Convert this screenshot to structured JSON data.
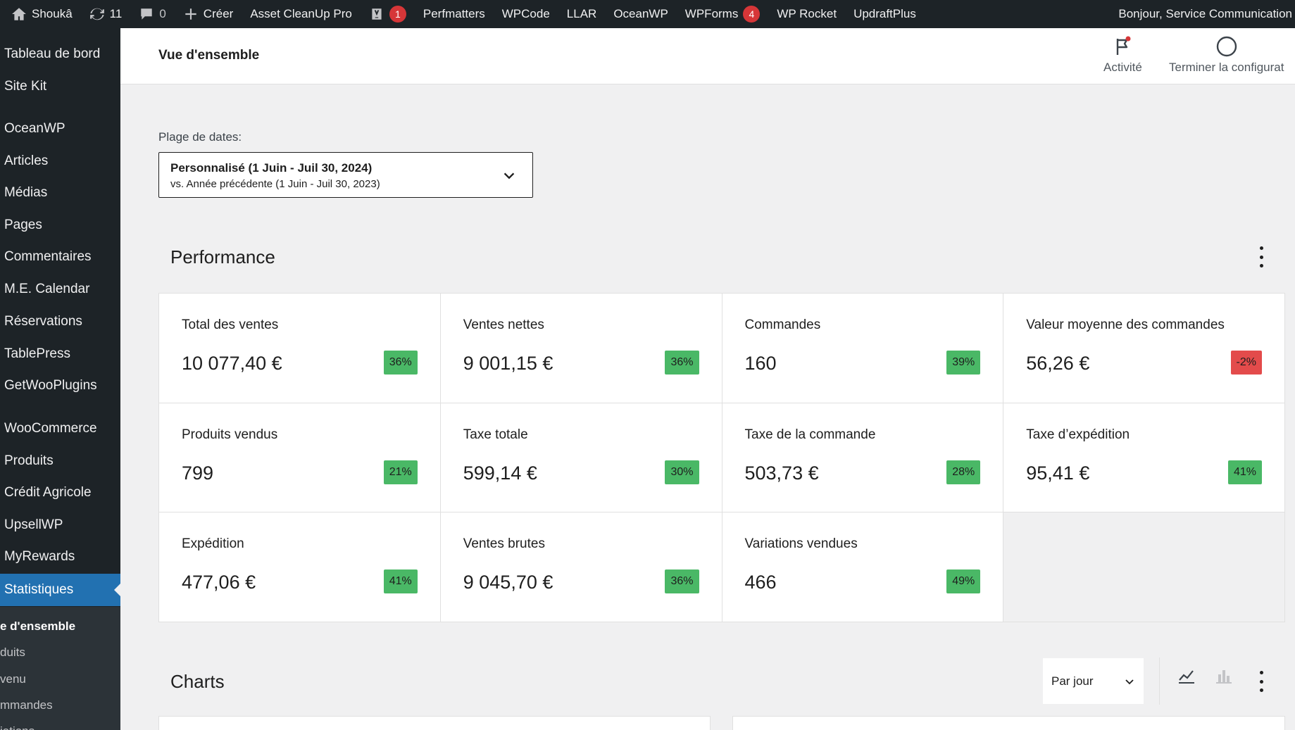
{
  "adminbar": {
    "site_name": "Shoukâ",
    "updates_count": "11",
    "comments_count": "0",
    "create_label": "Créer",
    "items": [
      {
        "label": "Asset CleanUp Pro"
      },
      {
        "label": "",
        "badge": "1",
        "icon": "yoast-icon"
      },
      {
        "label": "Perfmatters"
      },
      {
        "label": "WPCode"
      },
      {
        "label": "LLAR"
      },
      {
        "label": "OceanWP"
      },
      {
        "label": "WPForms",
        "badge": "4"
      },
      {
        "label": "WP Rocket"
      },
      {
        "label": "UpdraftPlus"
      }
    ],
    "greeting": "Bonjour, Service Communication"
  },
  "sidebar": {
    "items": [
      {
        "label": "Tableau de bord",
        "top": 0
      },
      {
        "label": "Site Kit"
      },
      {
        "label": "OceanWP"
      },
      {
        "label": "Articles"
      },
      {
        "label": "Médias"
      },
      {
        "label": "Pages"
      },
      {
        "label": "Commentaires"
      },
      {
        "label": "M.E. Calendar"
      },
      {
        "label": "Réservations"
      },
      {
        "label": "TablePress"
      },
      {
        "label": "GetWooPlugins"
      },
      {
        "label": "WooCommerce"
      },
      {
        "label": "Produits"
      },
      {
        "label": "Crédit Agricole"
      },
      {
        "label": "UpsellWP"
      },
      {
        "label": "MyRewards"
      },
      {
        "label": "Statistiques"
      }
    ],
    "submenu": [
      {
        "label": "e d'ensemble"
      },
      {
        "label": "duits"
      },
      {
        "label": "venu"
      },
      {
        "label": "mmandes"
      },
      {
        "label": "iations"
      }
    ]
  },
  "header": {
    "title": "Vue d'ensemble",
    "activity_label": "Activité",
    "setup_label": "Terminer la configurat"
  },
  "date_range": {
    "label": "Plage de dates:",
    "primary": "Personnalisé (1 Juin - Juil 30, 2024)",
    "comparison": "vs. Année précédente (1 Juin - Juil 30, 2023)"
  },
  "performance": {
    "title": "Performance",
    "cells": [
      {
        "label": "Total des ventes",
        "value": "10 077,40 €",
        "delta": "36%",
        "trend": "up"
      },
      {
        "label": "Ventes nettes",
        "value": "9 001,15 €",
        "delta": "36%",
        "trend": "up"
      },
      {
        "label": "Commandes",
        "value": "160",
        "delta": "39%",
        "trend": "up"
      },
      {
        "label": "Valeur moyenne des commandes",
        "value": "56,26 €",
        "delta": "-2%",
        "trend": "down"
      },
      {
        "label": "Produits vendus",
        "value": "799",
        "delta": "21%",
        "trend": "up"
      },
      {
        "label": "Taxe totale",
        "value": "599,14 €",
        "delta": "30%",
        "trend": "up"
      },
      {
        "label": "Taxe de la commande",
        "value": "503,73 €",
        "delta": "28%",
        "trend": "up"
      },
      {
        "label": "Taxe d’expédition",
        "value": "95,41 €",
        "delta": "41%",
        "trend": "up"
      },
      {
        "label": "Expédition",
        "value": "477,06 €",
        "delta": "41%",
        "trend": "up"
      },
      {
        "label": "Ventes brutes",
        "value": "9 045,70 €",
        "delta": "36%",
        "trend": "up"
      },
      {
        "label": "Variations vendues",
        "value": "466",
        "delta": "49%",
        "trend": "up"
      }
    ]
  },
  "charts": {
    "title": "Charts",
    "interval": "Par jour"
  },
  "colors": {
    "adminbar": "#1d2327",
    "active_menu": "#2271b1",
    "delta_up": "#4ab866",
    "delta_down": "#e34b4b",
    "badge": "#d63638"
  }
}
